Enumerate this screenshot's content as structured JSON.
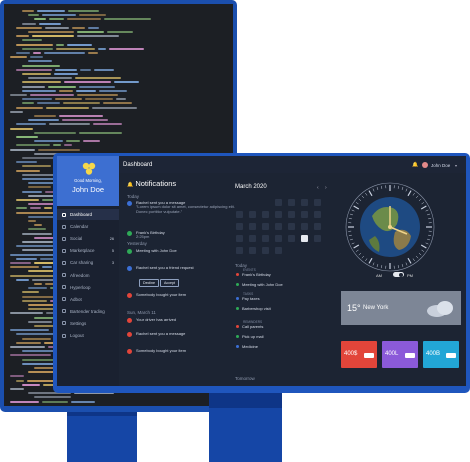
{
  "dashboard": {
    "title": "Dashboard",
    "user_name": "John Doe"
  },
  "profile": {
    "greeting": "Good Morning,",
    "name": "John Doe"
  },
  "sidebar": {
    "items": [
      {
        "label": "Dashboard",
        "badge": "",
        "active": true
      },
      {
        "label": "Calendar",
        "badge": ""
      },
      {
        "label": "Social",
        "badge": "26"
      },
      {
        "label": "Marketplace",
        "badge": "5"
      },
      {
        "label": "Car sharing",
        "badge": "3"
      },
      {
        "label": "Afreedom",
        "badge": ""
      },
      {
        "label": "Hyperloop",
        "badge": ""
      },
      {
        "label": "Adbot",
        "badge": ""
      },
      {
        "label": "Bartender trading",
        "badge": ""
      },
      {
        "label": "Settings",
        "badge": ""
      },
      {
        "label": "Logout",
        "badge": ""
      }
    ]
  },
  "notifications": {
    "title": "Notifications",
    "today_label": "Today",
    "yesterday_label": "Yesterday",
    "sun_label": "Sun, March 11",
    "items": [
      {
        "text": "Rachel sent you a message",
        "sub": "\"Lorem ipsum dolor sit amet, consectetur adipiscing elit. Donec porttitor vulputate.\"",
        "color": "#3b6fd6"
      },
      {
        "text": "Frank's Birthday",
        "sub": "2:25pm",
        "color": "#2faa57"
      },
      {
        "text": "Meeting with John Doe",
        "sub": "",
        "color": "#2faa57"
      },
      {
        "text": "Rachel sent you a friend request",
        "sub": "",
        "color": "#3b6fd6"
      },
      {
        "text": "Somebody bought your item",
        "sub": "",
        "color": "#e2453a"
      },
      {
        "text": "Your driver has arrived",
        "sub": "",
        "color": "#e2453a"
      },
      {
        "text": "Rachel sent you a message",
        "sub": "",
        "color": "#e2453a"
      },
      {
        "text": "Somebody bought your item",
        "sub": "",
        "color": "#e2453a"
      }
    ],
    "decline_label": "Decline",
    "accept_label": "Accept"
  },
  "calendar": {
    "title": "March 2020",
    "today_label": "Today",
    "tomorrow_label": "Tomorrow",
    "events": [
      {
        "label": "EVENTS",
        "text": "Frank's Birthday"
      },
      {
        "label": "",
        "text": "Meeting with John Doe"
      },
      {
        "label": "TASKS",
        "text": "Pay taxes"
      },
      {
        "label": "",
        "text": "Barbershop visit"
      },
      {
        "label": "REMINDERS",
        "text": "Call parents"
      },
      {
        "label": "",
        "text": "Pick up mail"
      },
      {
        "label": "",
        "text": "Medicine"
      }
    ]
  },
  "clock": {
    "am_label": "AM",
    "pm_label": "PM"
  },
  "weather": {
    "temp": "15°",
    "city": "New York"
  },
  "cards": [
    {
      "value": "400$",
      "color": "#e2453a"
    },
    {
      "value": "400L",
      "color": "#8b5ad9"
    },
    {
      "value": "400B",
      "color": "#22a6d6"
    }
  ]
}
